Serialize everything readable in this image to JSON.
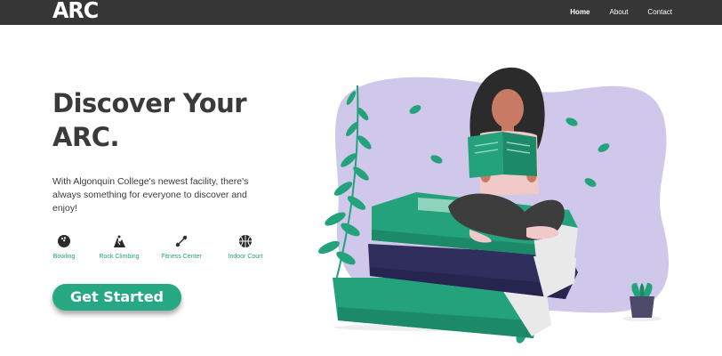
{
  "brand": {
    "logo_text": "ARC"
  },
  "nav": {
    "items": [
      {
        "label": "Home",
        "active": true
      },
      {
        "label": "About",
        "active": false
      },
      {
        "label": "Contact",
        "active": false
      }
    ]
  },
  "hero": {
    "title_line1": "Discover Your",
    "title_line2": "ARC.",
    "subtitle": "With Algonquin College's newest facility, there's always something for everyone to discover and enjoy!",
    "cta_label": "Get Started"
  },
  "features": [
    {
      "label": "Bowling",
      "icon": "bowling-ball-icon"
    },
    {
      "label": "Rock Climbing",
      "icon": "rock-climbing-icon"
    },
    {
      "label": "Fitness Center",
      "icon": "dumbbell-icon"
    },
    {
      "label": "Indoor Court",
      "icon": "basketball-icon"
    }
  ],
  "colors": {
    "navbar": "#363636",
    "accent_green": "#26a883",
    "text_dark": "#3a3a3a",
    "blob_lavender": "#cfc8ea",
    "book_navy": "#2f2e5c"
  }
}
